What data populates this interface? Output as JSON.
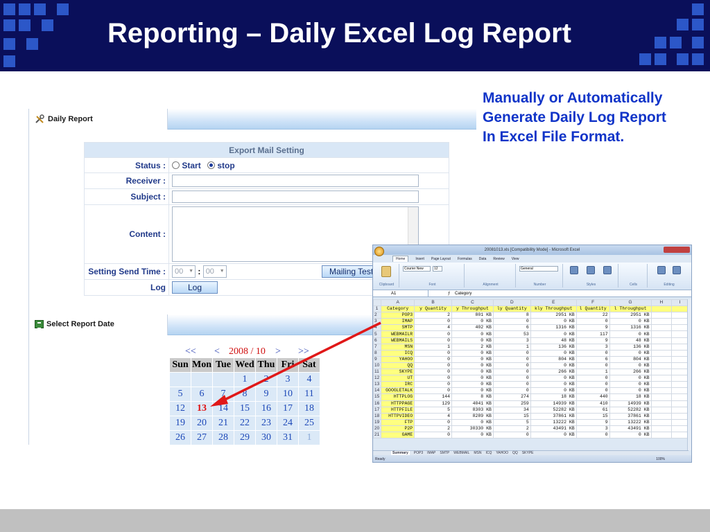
{
  "slide": {
    "title": "Reporting – Daily Excel Log Report",
    "note_lines": [
      "Manually or Automatically",
      "Generate Daily Log Report",
      "In Excel File Format."
    ],
    "accent_color": "#0a0f5a",
    "note_color": "#1034c8"
  },
  "daily_report": {
    "panel_title": "Daily Report",
    "icon": "tools-icon",
    "section_heading": "Export Mail Setting",
    "status_label": "Status :",
    "status_options": [
      "Start",
      "stop"
    ],
    "status_selected": "stop",
    "receiver_label": "Receiver :",
    "receiver_value": "",
    "subject_label": "Subject :",
    "subject_value": "",
    "content_label": "Content :",
    "content_value": "",
    "send_time_label": "Setting Send Time :",
    "hour_value": "00",
    "minute_value": "00",
    "time_separator": ":",
    "mailing_test_label": "Mailing Test",
    "log_label": "Log",
    "log_button_label": "Log"
  },
  "select_report_date": {
    "panel_title": "Select Report Date",
    "icon": "excel-icon",
    "nav_prev_year": "<<",
    "nav_prev_month": "<",
    "current": "2008 / 10",
    "nav_next_month": ">",
    "nav_next_year": ">>",
    "weekdays": [
      "Sun",
      "Mon",
      "Tue",
      "Wed",
      "Thu",
      "Fri",
      "Sat"
    ],
    "weeks": [
      [
        "",
        "",
        "",
        "1",
        "2",
        "3",
        "4"
      ],
      [
        "5",
        "6",
        "7",
        "8",
        "9",
        "10",
        "11"
      ],
      [
        "12",
        "13",
        "14",
        "15",
        "16",
        "17",
        "18"
      ],
      [
        "19",
        "20",
        "21",
        "22",
        "23",
        "24",
        "25"
      ],
      [
        "26",
        "27",
        "28",
        "29",
        "30",
        "31",
        "1"
      ]
    ],
    "today": "13",
    "today_color": "#e01010"
  },
  "excel": {
    "window_title": "20081013.xls [Compatibility Mode] - Microsoft Excel",
    "ribbon_tabs": [
      "Home",
      "Insert",
      "Page Layout",
      "Formulas",
      "Data",
      "Review",
      "View"
    ],
    "ribbon_groups": [
      "Clipboard",
      "Font",
      "Alignment",
      "Number",
      "Styles",
      "Cells",
      "Editing"
    ],
    "font_name": "Courier New",
    "font_size": "12",
    "number_format": "General",
    "name_box": "A1",
    "formula": "Category",
    "columns": [
      "",
      "A",
      "B",
      "C",
      "D",
      "E",
      "F",
      "G",
      "H",
      "I"
    ],
    "header_row": [
      "Category",
      "y Quantity",
      "y Throughput",
      "ly Quantity",
      "kly Throughput",
      "l Quantity",
      "l Throughput"
    ],
    "rows": [
      [
        "POP3",
        "2",
        "801 KB",
        "8",
        "2951 KB",
        "22",
        "2951 KB"
      ],
      [
        "IMAP",
        "0",
        "0 KB",
        "0",
        "0 KB",
        "0",
        "0 KB"
      ],
      [
        "SMTP",
        "4",
        "402 KB",
        "6",
        "1316 KB",
        "9",
        "1316 KB"
      ],
      [
        "WEBMAILR",
        "0",
        "0 KB",
        "53",
        "0 KB",
        "117",
        "0 KB"
      ],
      [
        "WEBMAILS",
        "0",
        "0 KB",
        "3",
        "48 KB",
        "9",
        "48 KB"
      ],
      [
        "MSN",
        "1",
        "2 KB",
        "1",
        "136 KB",
        "3",
        "136 KB"
      ],
      [
        "ICQ",
        "0",
        "0 KB",
        "0",
        "0 KB",
        "0",
        "0 KB"
      ],
      [
        "YAHOO",
        "0",
        "0 KB",
        "0",
        "804 KB",
        "6",
        "804 KB"
      ],
      [
        "QQ",
        "0",
        "0 KB",
        "0",
        "0 KB",
        "0",
        "0 KB"
      ],
      [
        "SKYPE",
        "0",
        "0 KB",
        "0",
        "266 KB",
        "1",
        "266 KB"
      ],
      [
        "UT",
        "0",
        "0 KB",
        "0",
        "0 KB",
        "0",
        "0 KB"
      ],
      [
        "IRC",
        "0",
        "0 KB",
        "0",
        "0 KB",
        "0",
        "0 KB"
      ],
      [
        "GOOGLETALK",
        "0",
        "0 KB",
        "0",
        "0 KB",
        "0",
        "0 KB"
      ],
      [
        "HTTPLOG",
        "144",
        "8 KB",
        "274",
        "18 KB",
        "440",
        "18 KB"
      ],
      [
        "HTTPPAGE",
        "129",
        "4041 KB",
        "259",
        "14939 KB",
        "410",
        "14939 KB"
      ],
      [
        "HTTPFILE",
        "5",
        "8303 KB",
        "34",
        "52282 KB",
        "61",
        "52282 KB"
      ],
      [
        "HTTPVIDEO",
        "4",
        "8289 KB",
        "15",
        "37861 KB",
        "15",
        "37861 KB"
      ],
      [
        "FTP",
        "0",
        "0 KB",
        "5",
        "13222 KB",
        "9",
        "13222 KB"
      ],
      [
        "P2P",
        "2",
        "30330 KB",
        "2",
        "43491 KB",
        "3",
        "43491 KB"
      ],
      [
        "GAME",
        "0",
        "0 KB",
        "0",
        "0 KB",
        "0",
        "0 KB"
      ]
    ],
    "sheet_tabs": [
      "Summary",
      "POP3",
      "IMAP",
      "SMTP",
      "WEBMAIL",
      "MSN",
      "ICQ",
      "YAHOO",
      "QQ",
      "SKYPE"
    ],
    "active_sheet": "Summary",
    "status": "Ready",
    "zoom": "100%",
    "highlight_color": "#ffff80"
  },
  "annotation": {
    "arrow_color": "#e01818"
  }
}
